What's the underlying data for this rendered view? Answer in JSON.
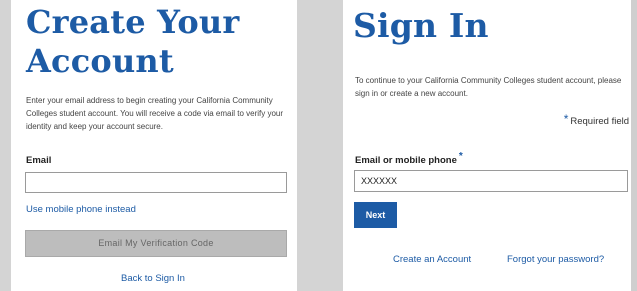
{
  "create_account": {
    "title": "Create Your Account",
    "description": "Enter your email address to begin creating your California Community Colleges student account. You will receive a code via email to verify your identity and keep your account secure.",
    "email_label": "Email",
    "email_value": "",
    "mobile_link": "Use mobile phone instead",
    "verify_button": "Email My Verification Code",
    "back_link": "Back to Sign In"
  },
  "sign_in": {
    "title": "Sign In",
    "description": "To continue to your California Community Colleges student account, please sign in or create a new account.",
    "required_star": "*",
    "required_text": "Required field",
    "field_label": "Email or mobile phone",
    "field_star": "*",
    "field_value": "XXXXXX",
    "next_button": "Next",
    "create_account_link": "Create an Account",
    "forgot_link": "Forgot your password?"
  },
  "colors": {
    "accent": "#1d5ba5",
    "disabled_button": "#bdbdbd",
    "background": "#d4d4d4"
  }
}
